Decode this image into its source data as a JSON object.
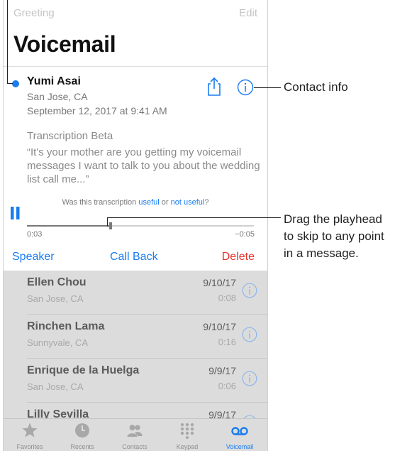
{
  "nav": {
    "left_label": "Greeting",
    "right_label": "Edit"
  },
  "page_title": "Voicemail",
  "selected": {
    "caller": "Yumi Asai",
    "location": "San Jose, CA",
    "date": "September 12, 2017 at 9:41 AM",
    "transcription_title": "Transcription Beta",
    "transcription_text": "“It's your mother are you getting my voicemail messages I want to talk to you about the wedding list call me...”",
    "feedback_prefix": "Was this transcription ",
    "feedback_useful": "useful",
    "feedback_or": " or ",
    "feedback_not_useful": "not useful",
    "feedback_suffix": "?",
    "elapsed": "0:03",
    "remaining": "−0:05",
    "progress": 0.37
  },
  "actions": {
    "speaker": "Speaker",
    "call_back": "Call Back",
    "delete": "Delete"
  },
  "list": [
    {
      "name": "Ellen Chou",
      "location": "San Jose, CA",
      "date": "9/10/17",
      "duration": "0:08"
    },
    {
      "name": "Rinchen Lama",
      "location": "Sunnyvale, CA",
      "date": "9/10/17",
      "duration": "0:16"
    },
    {
      "name": "Enrique de la Huelga",
      "location": "San Jose, CA",
      "date": "9/9/17",
      "duration": "0:06"
    },
    {
      "name": "Lilly Sevilla",
      "location": "",
      "date": "9/9/17",
      "duration": ""
    }
  ],
  "tabs": [
    {
      "label": "Favorites",
      "icon": "star-icon"
    },
    {
      "label": "Recents",
      "icon": "clock-icon"
    },
    {
      "label": "Contacts",
      "icon": "contacts-icon"
    },
    {
      "label": "Keypad",
      "icon": "keypad-icon"
    },
    {
      "label": "Voicemail",
      "icon": "voicemail-icon",
      "active": true
    }
  ],
  "callouts": {
    "contact_info": "Contact info",
    "playhead_line1": "Drag the playhead",
    "playhead_line2": "to skip to any point",
    "playhead_line3": "in a message."
  },
  "colors": {
    "accent": "#1a7cf0",
    "destructive": "#e8302c",
    "list_bg": "#dcdcdc"
  }
}
